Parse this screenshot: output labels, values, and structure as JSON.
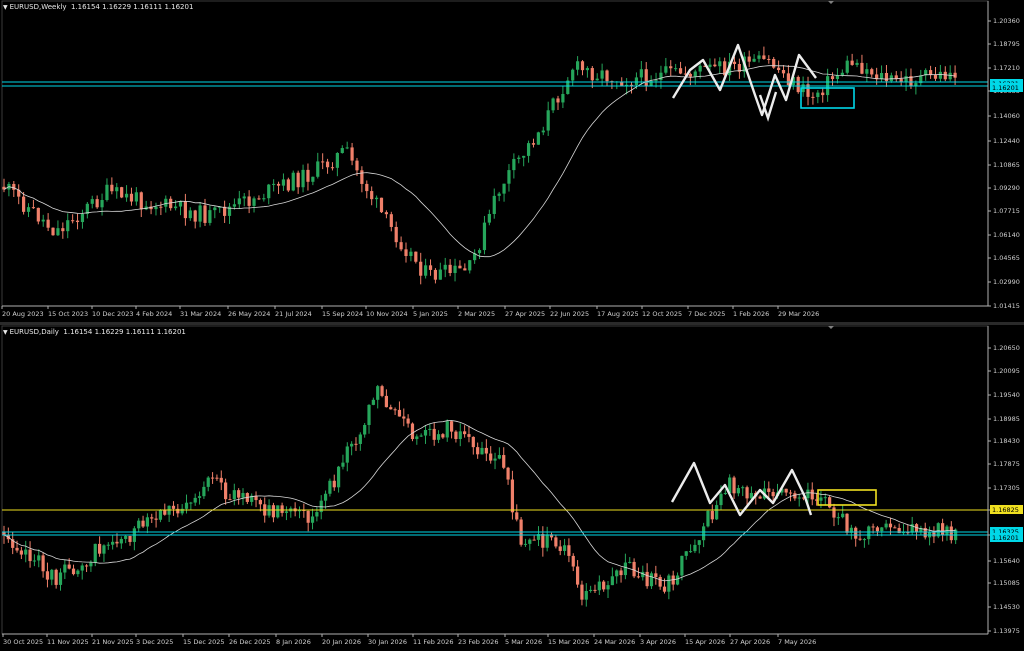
{
  "colors": {
    "background": "#000000",
    "bull": "#26a65b",
    "bear": "#f0806a",
    "ma": "#d8d8d8",
    "pattern": "#ececec",
    "axis_text": "#d0d0d0",
    "cyan": "#00d8e8",
    "yellow": "#f0e020",
    "frame": "#b0b0b0"
  },
  "charts": [
    {
      "id": "weekly",
      "title": "EURUSD,Weekly",
      "ohlc": "1.16154 1.16229 1.16111 1.16201",
      "price_ticks": [
        "1.20360",
        "1.18795",
        "1.17210",
        "1.15635",
        "1.14060",
        "1.12440",
        "1.10865",
        "1.09290",
        "1.07715",
        "1.06140",
        "1.04565",
        "1.02990",
        "1.01415"
      ],
      "date_ticks": [
        "20 Aug 2023",
        "15 Oct 2023",
        "10 Dec 2023",
        "4 Feb 2024",
        "31 Mar 2024",
        "26 May 2024",
        "21 Jul 2024",
        "15 Sep 2024",
        "10 Nov 2024",
        "5 Jan 2025",
        "2 Mar 2025",
        "27 Apr 2025",
        "22 Jun 2025",
        "17 Aug 2025",
        "12 Oct 2025",
        "7 Dec 2025",
        "1 Feb 2026",
        "29 Mar 2026"
      ],
      "price_tags": [
        {
          "label": "1.16321",
          "color": "cyan"
        },
        {
          "label": "1.16201",
          "color": "cyan"
        }
      ]
    },
    {
      "id": "daily",
      "title": "EURUSD,Daily",
      "ohlc": "1.16154 1.16229 1.16111 1.16201",
      "price_ticks": [
        "1.20650",
        "1.20095",
        "1.19540",
        "1.18985",
        "1.18430",
        "1.17875",
        "1.17305",
        "1.16825",
        "1.16201",
        "1.15640",
        "1.15085",
        "1.14530",
        "1.13975"
      ],
      "date_ticks": [
        "30 Oct 2025",
        "11 Nov 2025",
        "21 Nov 2025",
        "3 Dec 2025",
        "15 Dec 2025",
        "26 Dec 2025",
        "8 Jan 2026",
        "20 Jan 2026",
        "30 Jan 2026",
        "11 Feb 2026",
        "23 Feb 2026",
        "5 Mar 2026",
        "15 Mar 2026",
        "24 Mar 2026",
        "3 Apr 2026",
        "15 Apr 2026",
        "27 Apr 2026",
        "7 May 2026"
      ],
      "price_tags": [
        {
          "label": "1.16825",
          "color": "yellow"
        },
        {
          "label": "1.16325",
          "color": "cyan"
        },
        {
          "label": "1.16201",
          "color": "cyan"
        }
      ]
    }
  ]
}
